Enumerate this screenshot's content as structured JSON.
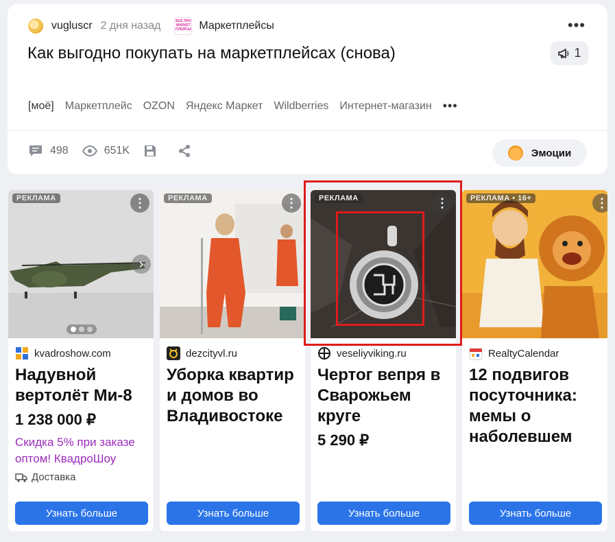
{
  "post": {
    "author": "vugluscr",
    "date": "2 дня назад",
    "channel": "Маркетплейсы",
    "channel_logo_text": "ВСЁ ПРО МАРКЕТ ПЛЕЙСЫ",
    "title": "Как выгодно покупать на маркетплейсах (снова)",
    "report_count": "1",
    "tags": [
      "[моё]",
      "Маркетплейс",
      "OZON",
      "Яндекс Маркет",
      "Wildberries",
      "Интернет-магазин"
    ],
    "tags_more": "•••",
    "more": "•••",
    "comments": "498",
    "views": "651K",
    "emotions_label": "Эмоции"
  },
  "ads": [
    {
      "badge": "РЕКЛАМА",
      "domain": "kvadroshow.com",
      "title": "Надувной вертолёт Ми-8",
      "price": "1 238 000 ₽",
      "promo": "Скидка 5% при заказе оптом! КвадроШоу",
      "delivery": "Доставка",
      "button": "Узнать больше",
      "favicon_color": "#2f6fe0"
    },
    {
      "badge": "РЕКЛАМА",
      "domain": "dezcityvl.ru",
      "title": "Уборка квартир и домов во Владивостоке",
      "button": "Узнать больше",
      "favicon_color": "#222222"
    },
    {
      "badge": "РЕКЛАМА",
      "domain": "veseliyviking.ru",
      "title": "Чертог вепря в Сварожьем круге",
      "price": "5 290 ₽",
      "button": "Узнать больше",
      "favicon_color": "#111111"
    },
    {
      "badge": "РЕКЛАМА • 16+",
      "domain": "RealtyCalendar",
      "title": "12 подвигов посуточника: мемы о наболевшем",
      "button": "Узнать больше",
      "favicon_color": "#f2b01e"
    }
  ],
  "colors": {
    "accent_button": "#2a74e8",
    "promo_text": "#9b2bbd",
    "highlight_frame": "#e01b1b"
  }
}
